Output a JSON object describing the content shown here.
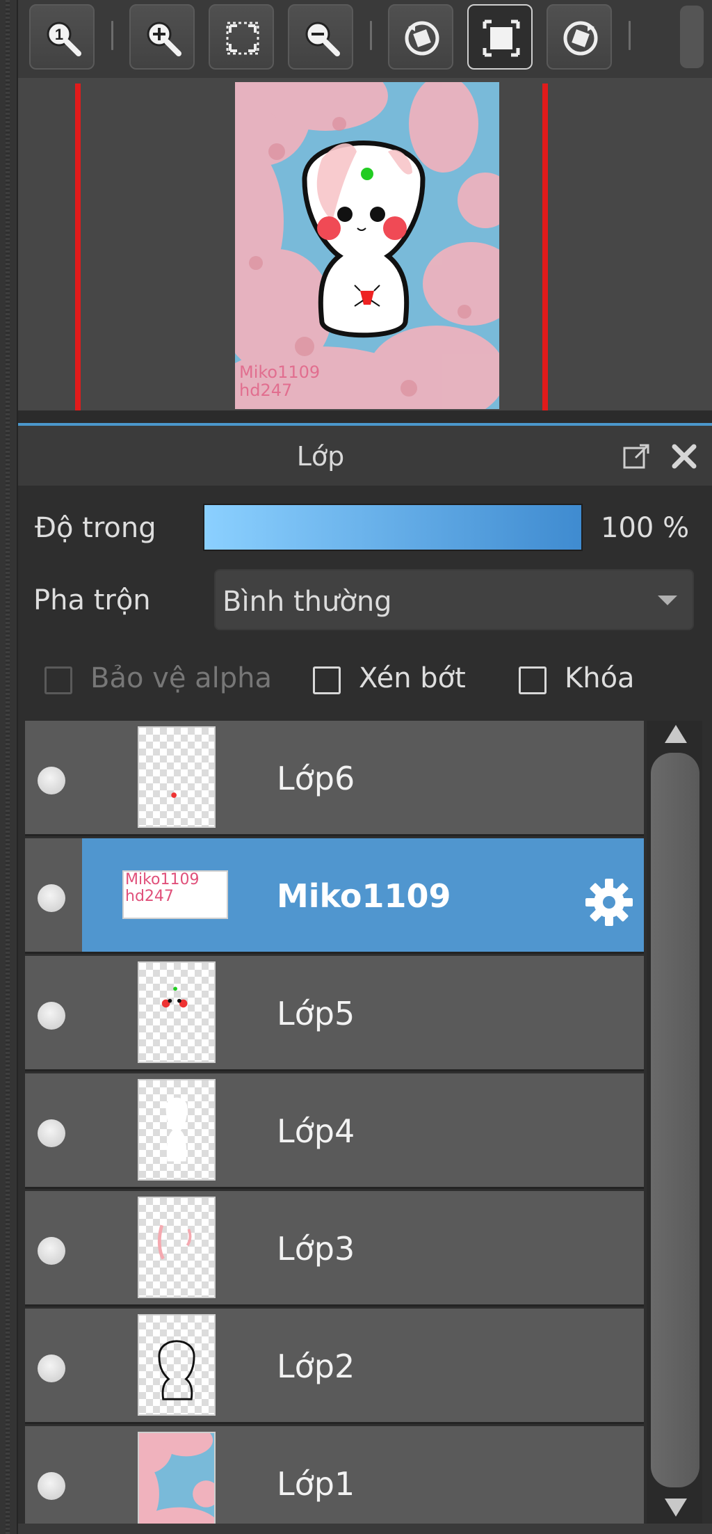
{
  "toolbar": {
    "buttons": [
      {
        "icon": "zoom-actual-size-icon"
      },
      {
        "icon": "zoom-in-icon"
      },
      {
        "icon": "fit-to-window-icon"
      },
      {
        "icon": "zoom-out-icon"
      },
      {
        "icon": "rotate-left-icon"
      },
      {
        "icon": "fullscreen-icon",
        "active": true
      },
      {
        "icon": "rotate-right-icon"
      }
    ]
  },
  "preview": {
    "watermark": "Miko1109\nhd247"
  },
  "layers_panel": {
    "title": "Lớp",
    "opacity_label": "Độ trong",
    "opacity_value": "100 %",
    "opacity_fraction": 1.0,
    "blend_label": "Pha trộn",
    "blend_value": "Bình thường",
    "protect_alpha_label": "Bảo vệ alpha",
    "clipping_label": "Xén bớt",
    "lock_label": "Khóa",
    "layers": [
      {
        "name": "Lớp6",
        "selected": false,
        "thumb": "red-dot"
      },
      {
        "name": "Miko1109",
        "selected": true,
        "thumb": "text",
        "thumb_text": [
          "Miko1109",
          "hd247"
        ]
      },
      {
        "name": "Lớp5",
        "selected": false,
        "thumb": "face-parts"
      },
      {
        "name": "Lớp4",
        "selected": false,
        "thumb": "white-body"
      },
      {
        "name": "Lớp3",
        "selected": false,
        "thumb": "pink-marks"
      },
      {
        "name": "Lớp2",
        "selected": false,
        "thumb": "outline"
      },
      {
        "name": "Lớp1",
        "selected": false,
        "thumb": "background"
      }
    ]
  },
  "colors": {
    "accent": "#5096cf",
    "guide_line": "#e21b1b"
  }
}
